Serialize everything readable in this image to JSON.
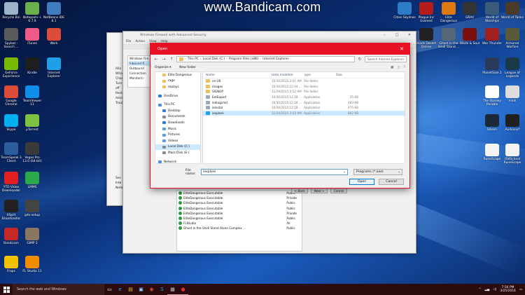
{
  "watermark": "www.Bandicam.com",
  "desktop": {
    "left_icons": [
      {
        "label": "Recycle Bin",
        "icon": "recycle-bin-icon",
        "color": "#9cb4c8"
      },
      {
        "label": "Notepad++ 6.7.9",
        "icon": "notepad-icon",
        "color": "#6ab04c"
      },
      {
        "label": "NetBeans IDE 8.1",
        "icon": "netbeans-icon",
        "color": "#3f7dc0"
      },
      {
        "label": "Spybot - Search ...",
        "icon": "spybot-icon",
        "color": "#5a5a5a"
      },
      {
        "label": "iTunes",
        "icon": "itunes-icon",
        "color": "#ef5a8a"
      },
      {
        "label": "Work",
        "icon": "chrome-icon",
        "color": "#dd4b39"
      },
      {
        "label": "GeForce Experience",
        "icon": "geforce-icon",
        "color": "#76b900"
      },
      {
        "label": "Kindle",
        "icon": "kindle-icon",
        "color": "#1e1e1e"
      },
      {
        "label": "Internet Explorer",
        "icon": "ie-icon",
        "color": "#1ea0e8"
      },
      {
        "label": "Google Chrome",
        "icon": "chrome-icon",
        "color": "#dd4b39"
      },
      {
        "label": "TeamViewer 11",
        "icon": "teamviewer-icon",
        "color": "#0e8ee9"
      },
      {
        "label": "Skype",
        "icon": "skype-icon",
        "color": "#00aff0"
      },
      {
        "label": "µTorrent",
        "icon": "utorrent-icon",
        "color": "#7fc241"
      },
      {
        "label": "TeamSpeak 3 Client",
        "icon": "teamspeak-icon",
        "color": "#2d5d9c"
      },
      {
        "label": "Vegas Pro 13.0 (64-bit)",
        "icon": "vegas-icon",
        "color": "#3a3a3a"
      },
      {
        "label": "YTD Video Downloader",
        "icon": "ytd-icon",
        "color": "#e02020"
      },
      {
        "label": "LMMS",
        "icon": "lmms-icon",
        "color": "#2aa84a"
      },
      {
        "label": "XSplit Broadcaster",
        "icon": "xsplit-icon",
        "color": "#222222"
      },
      {
        "label": "gdx-setup",
        "icon": "gdx-icon",
        "color": "#444444"
      },
      {
        "label": "Bandicam",
        "icon": "bandicam-icon",
        "color": "#c62828"
      },
      {
        "label": "GIMP 2",
        "icon": "gimp-icon",
        "color": "#8a7560"
      },
      {
        "label": "Fraps",
        "icon": "fraps-icon",
        "color": "#f2c200"
      },
      {
        "label": "FL Studio 11",
        "icon": "flstudio-icon",
        "color": "#f08c00"
      }
    ],
    "right_icons": [
      {
        "label": "Cities Skylines",
        "icon": "cities-icon",
        "color": "#2e7bc6"
      },
      {
        "label": "Plague Inc Evolved",
        "icon": "plague-icon",
        "color": "#b71c1c"
      },
      {
        "label": "Elite Dangerous",
        "icon": "elite-icon",
        "color": "#e07a10"
      },
      {
        "label": "GRAV",
        "icon": "grav-icon",
        "color": "#333333"
      },
      {
        "label": "World of Warships",
        "icon": "warships-icon",
        "color": "#3b5b7a"
      },
      {
        "label": "World of Tanks",
        "icon": "tanks-icon",
        "color": "#4a3a2a"
      },
      {
        "label": "Black Desert Online",
        "icon": "blackdesert-icon",
        "color": "#222222"
      },
      {
        "label": "Ghost in the Shell Stand ...",
        "icon": "ghost-icon",
        "color": "#556677"
      },
      {
        "label": "Blade & Soul",
        "icon": "bladesoul-icon",
        "color": "#7a1010"
      },
      {
        "label": "War Thunder",
        "icon": "warthunder-icon",
        "color": "#a02020"
      },
      {
        "label": "Armored Warfare",
        "icon": "armored-icon",
        "color": "#5a5a3a"
      },
      {
        "label": "PlanetSide 2",
        "icon": "planetside-icon",
        "color": "#2a3a5a"
      },
      {
        "label": "League of Legends",
        "icon": "lol-icon",
        "color": "#1a3a4a"
      },
      {
        "label": "The Stanley Parable",
        "icon": "stanley-icon",
        "color": "#ffffff"
      },
      {
        "label": "Vindi",
        "icon": "vindi-icon",
        "color": "#dddddd"
      },
      {
        "label": "Steam",
        "icon": "steam-icon",
        "color": "#1b2838"
      },
      {
        "label": "Audiosurf",
        "icon": "audiosurf-icon",
        "color": "#202020"
      },
      {
        "label": "RuneScape",
        "icon": "runescape-icon",
        "color": "#f4f4f4"
      },
      {
        "label": "OldSchool RuneScape",
        "icon": "osrs-icon",
        "color": "#f4f4f4"
      }
    ]
  },
  "firewall": {
    "title": "Windows Firewall with Advanced Security",
    "menu": [
      "File",
      "Action",
      "View",
      "Help"
    ],
    "tree": [
      "Windows Fire...",
      "Inbound R...",
      "Outbound",
      "Connection",
      "Monitorin"
    ],
    "behind_text": [
      "Allo",
      "Wha",
      "Chan",
      "Turn",
      "off",
      "Resto",
      "Advan",
      "Troub",
      "Sec",
      "Inte",
      "Netw"
    ],
    "rules": [
      {
        "name": "EliteDangerous Executable",
        "profile": "Public"
      },
      {
        "name": "EliteDangerous Executable",
        "profile": "Private"
      },
      {
        "name": "EliteDangerous Executable",
        "profile": "Public"
      },
      {
        "name": "EliteDangerous Executable",
        "profile": "Public"
      },
      {
        "name": "EliteDangerous Executable",
        "profile": "Private"
      },
      {
        "name": "EliteDangerous Executable",
        "profile": "Public"
      },
      {
        "name": "FLStudio",
        "profile": "All"
      },
      {
        "name": "Ghost in the Shell Stand Alone Complex ...",
        "profile": "Public"
      }
    ],
    "wizard_buttons": {
      "back": "< Back",
      "next": "Next >",
      "cancel": "Cancel"
    }
  },
  "open_dialog": {
    "title": "Open",
    "path": [
      "This PC",
      "Local Disk (C:)",
      "Program Files (x86)",
      "Internet Explorer"
    ],
    "search_placeholder": "Search Internet Explorer",
    "organize": "Organize ▾",
    "new_folder": "New folder",
    "nav": [
      {
        "label": "Elite Dangerous",
        "type": "folder",
        "selected": false,
        "top": false
      },
      {
        "label": "rage",
        "type": "folder",
        "selected": false,
        "top": false
      },
      {
        "label": "replays",
        "type": "folder",
        "selected": false,
        "top": false
      },
      {
        "label": "OneDrive",
        "type": "onedrive",
        "selected": false,
        "top": true
      },
      {
        "label": "This PC",
        "type": "pc",
        "selected": false,
        "top": true
      },
      {
        "label": "Desktop",
        "type": "desktop",
        "selected": false,
        "top": false
      },
      {
        "label": "Documents",
        "type": "docs",
        "selected": false,
        "top": false
      },
      {
        "label": "Downloads",
        "type": "downloads",
        "selected": false,
        "top": false
      },
      {
        "label": "Music",
        "type": "music",
        "selected": false,
        "top": false
      },
      {
        "label": "Pictures",
        "type": "pictures",
        "selected": false,
        "top": false
      },
      {
        "label": "Videos",
        "type": "videos",
        "selected": false,
        "top": false
      },
      {
        "label": "Local Disk (C:)",
        "type": "drive",
        "selected": true,
        "top": false
      },
      {
        "label": "Mass Disk (E:)",
        "type": "drive",
        "selected": false,
        "top": false
      },
      {
        "label": "Network",
        "type": "network",
        "selected": false,
        "top": true
      }
    ],
    "columns": [
      "Name",
      "Date modified",
      "Type",
      "Size"
    ],
    "files": [
      {
        "name": "en-US",
        "date": "10/30/2015 2:02 AM",
        "type": "File folder",
        "size": "",
        "kind": "folder",
        "selected": false
      },
      {
        "name": "images",
        "date": "10/30/2015 12:04 ...",
        "type": "File folder",
        "size": "",
        "kind": "folder",
        "selected": false
      },
      {
        "name": "SIGNUP",
        "date": "11/29/2015 3:52 AM",
        "type": "File folder",
        "size": "",
        "kind": "folder",
        "selected": false
      },
      {
        "name": "ExtExport",
        "date": "10/30/2015 12:18 ...",
        "type": "Application",
        "size": "25 KB",
        "kind": "app",
        "selected": false
      },
      {
        "name": "iediagcmd",
        "date": "10/30/2015 12:18 ...",
        "type": "Application",
        "size": "483 KB",
        "kind": "app",
        "selected": false
      },
      {
        "name": "ieinstal",
        "date": "10/30/2015 12:18 ...",
        "type": "Application",
        "size": "475 KB",
        "kind": "app",
        "selected": false
      },
      {
        "name": "iexplore",
        "date": "11/24/2015 2:03 AM",
        "type": "Application",
        "size": "802 KB",
        "kind": "ie",
        "selected": true
      }
    ],
    "filename_label": "File name:",
    "filename_value": "iexplore",
    "filetype": "Programs (*.exe)",
    "open_button": "Open",
    "cancel_button": "Cancel"
  },
  "taskbar": {
    "search_placeholder": "Search the web and Windows",
    "apps": [
      "task-view-icon",
      "edge-icon",
      "file-explorer-icon",
      "store-icon",
      "chrome-icon",
      "skype-icon",
      "firewall-icon",
      "bandicam-icon"
    ],
    "time": "7:56 PM",
    "date": "3/25/2016"
  }
}
